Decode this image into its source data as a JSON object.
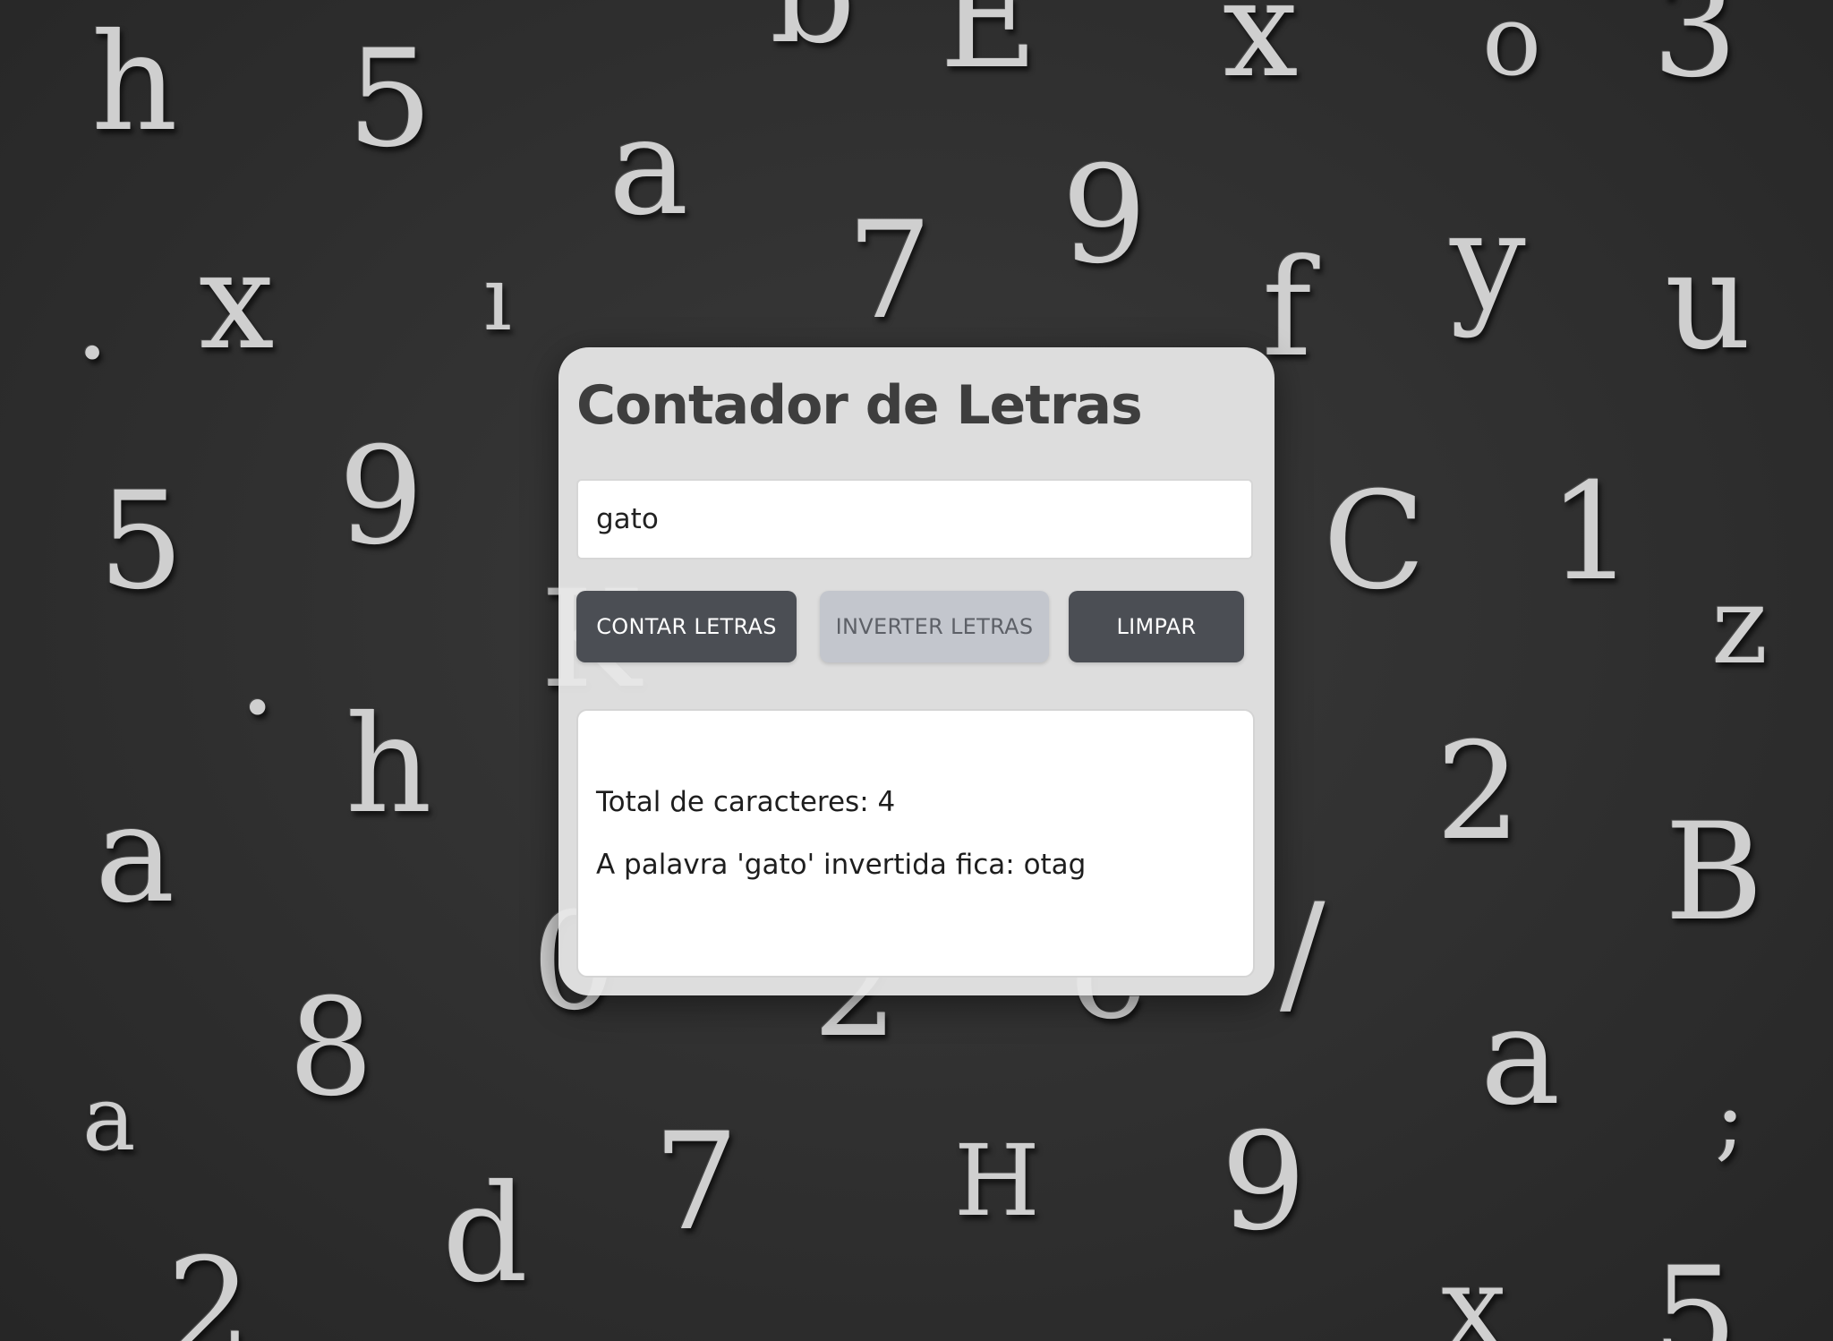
{
  "background": {
    "glyphs": [
      "h",
      "5",
      "b",
      "E",
      "x",
      "o",
      "3",
      "a",
      "9",
      "7",
      "y",
      "u",
      ".",
      "x",
      "ı",
      "f",
      "5",
      "9",
      "C",
      "1",
      "z",
      "K",
      "•",
      "h",
      "a",
      "2",
      "B",
      "0",
      "2",
      "c",
      "/",
      "8",
      "a",
      "a",
      ";",
      "7",
      "H",
      "9",
      "d",
      "2",
      "x",
      "5"
    ]
  },
  "app": {
    "title": "Contador de Letras",
    "input": {
      "value": "gato",
      "placeholder": ""
    },
    "buttons": {
      "count_label": "CONTAR LETRAS",
      "invert_label": "INVERTER LETRAS",
      "clear_label": "LIMPAR"
    },
    "result": {
      "total_text": "Total de caracteres: 4",
      "inverted_text": "A palavra 'gato' invertida fica: otag"
    }
  },
  "colors": {
    "card": "#e8e8e8",
    "button_dark": "#4b4e54",
    "button_light": "#c3c6cd",
    "title": "#3e3e3e",
    "background": "#2f2f2f"
  }
}
